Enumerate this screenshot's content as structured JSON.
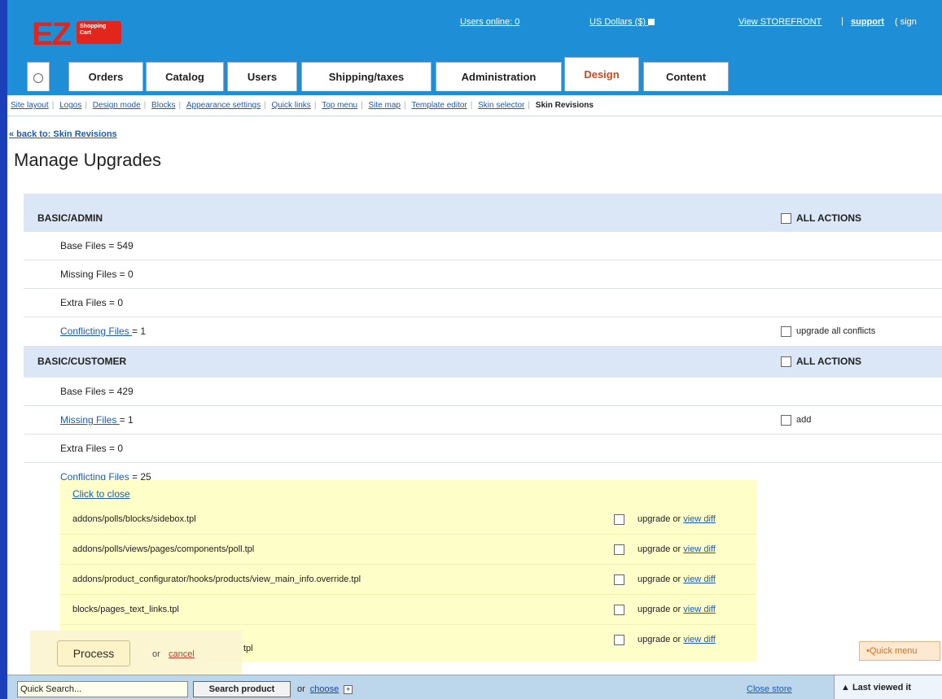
{
  "header": {
    "logo_text": "EZ",
    "logo_badge": "Shopping Cart",
    "users_online": "Users online: 0",
    "currency": "US Dollars ($)",
    "view_storefront": "View STOREFRONT",
    "separator": "|",
    "support": "support",
    "sign": "( sign"
  },
  "tabs": [
    {
      "label": "Orders"
    },
    {
      "label": "Catalog"
    },
    {
      "label": "Users"
    },
    {
      "label": "Shipping/taxes"
    },
    {
      "label": "Administration"
    },
    {
      "label": "Design"
    },
    {
      "label": "Content"
    }
  ],
  "subnav": {
    "items": [
      "Site layout",
      "Logos",
      "Design mode",
      "Blocks",
      "Appearance settings",
      "Quick links",
      "Top menu",
      "Site map",
      "Template editor",
      "Skin selector"
    ],
    "current": "Skin Revisions",
    "separator": "|"
  },
  "back_link": "« back to: Skin Revisions",
  "page_title": "Manage Upgrades",
  "sections": {
    "admin": {
      "title": "BASIC/ADMIN",
      "all_actions": "ALL ACTIONS",
      "base_files": "Base Files = 549",
      "missing_files": "Missing Files = 0",
      "extra_files": "Extra Files = 0",
      "conflicting_link": "Conflicting Files ",
      "conflicting_count": "= 1",
      "upgrade_all": "upgrade all conflicts"
    },
    "customer": {
      "title": "BASIC/CUSTOMER",
      "all_actions": "ALL ACTIONS",
      "base_files": "Base Files = 429",
      "missing_link": "Missing Files ",
      "missing_count": "= 1",
      "add_label": "add",
      "extra_files": "Extra Files = 0",
      "conflicting_link": "Conflicting Files ",
      "conflicting_count": "= 25"
    }
  },
  "conflicts": {
    "close_label": "Click to close",
    "upgrade_or": "upgrade or",
    "view_diff": "view diff",
    "files": [
      "addons/polls/blocks/sidebox.tpl",
      "addons/polls/views/pages/components/poll.tpl",
      "addons/product_configurator/hooks/products/view_main_info.override.tpl",
      "blocks/pages_text_links.tpl"
    ]
  },
  "footer_actions": {
    "process": "Process",
    "or": "or",
    "cancel": "cancel",
    "partial_tpl": "tpl",
    "quick_menu": "•Quick menu"
  },
  "bottombar": {
    "quick_search_value": "Quick Search...",
    "search_button": "Search product",
    "or": "or",
    "choose": "choose",
    "plus": "+",
    "close_store": "Close store",
    "last_viewed": "▲ Last viewed it"
  },
  "colors": {
    "header_bg": "#1e8fd6",
    "accent_red": "#e3261d",
    "active_tab_text": "#d4461d",
    "section_bg": "#dbe6f6",
    "conflict_bg": "#fefec8",
    "link": "#1a5bb8"
  }
}
